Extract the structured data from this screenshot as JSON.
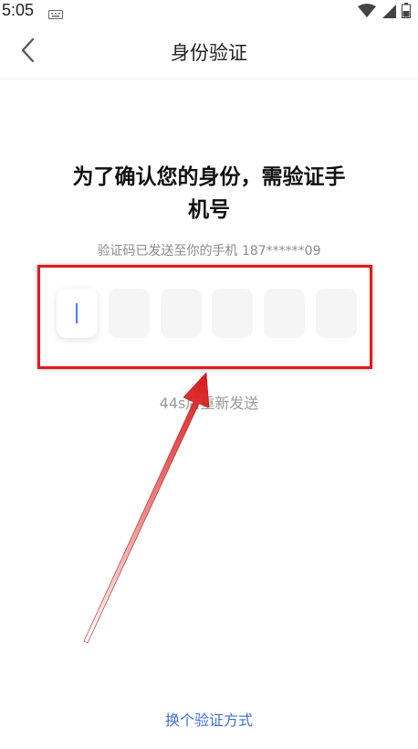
{
  "status_bar": {
    "time": "5:05",
    "icons": [
      "keyboard-icon",
      "wifi-icon",
      "signal-icon",
      "battery-icon"
    ]
  },
  "header": {
    "title": "身份验证",
    "back_icon": "chevron-left-icon"
  },
  "main": {
    "title_line1": "为了确认您的身份，需验证手",
    "title_line2": "机号",
    "sent_text": "验证码已发送至你的手机 187******09",
    "code_boxes": [
      "",
      "",
      "",
      "",
      "",
      ""
    ],
    "resend_text": "44s后重新发送"
  },
  "footer": {
    "switch_method": "换个验证方式"
  },
  "colors": {
    "accent": "#3f6fd8",
    "caret": "#4a7cf4",
    "annotation": "#e31b1b"
  }
}
